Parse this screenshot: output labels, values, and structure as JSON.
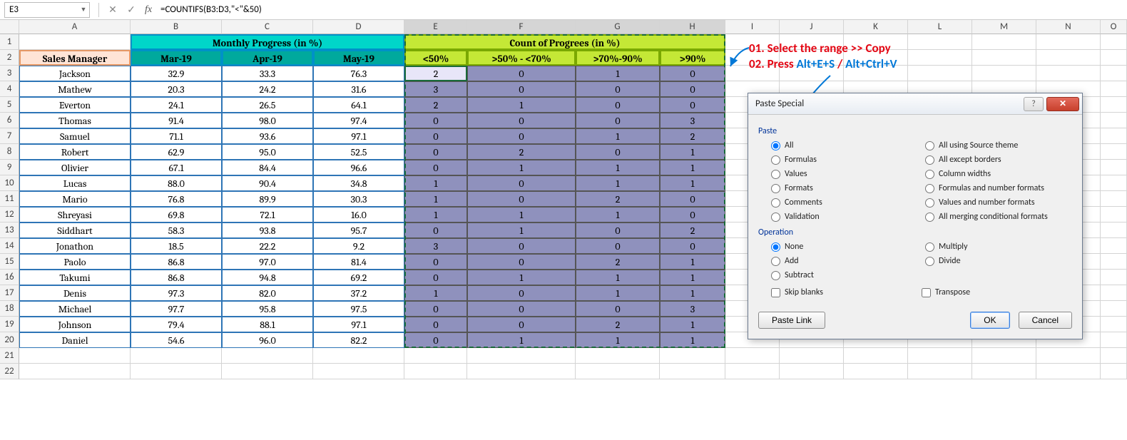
{
  "namebox": "E3",
  "formula": "=COUNTIFS(B3:D3,\"<\"&50)",
  "colHeaders": [
    "A",
    "B",
    "C",
    "D",
    "E",
    "F",
    "G",
    "H",
    "I",
    "J",
    "K",
    "L",
    "M",
    "N",
    "O"
  ],
  "rowCount": 22,
  "titles": {
    "monthly": "Monthly Progress (in %)",
    "count": "Count of Progrees (in %)"
  },
  "headers": {
    "salesManager": "Sales Manager",
    "months": [
      "Mar-19",
      "Apr-19",
      "May-19"
    ],
    "counts": [
      "<50%",
      ">50% - <70%",
      ">70%-90%",
      ">90%"
    ]
  },
  "rows": [
    {
      "name": "Jackson",
      "p": [
        "32.9",
        "33.3",
        "76.3"
      ],
      "c": [
        "2",
        "0",
        "1",
        "0"
      ]
    },
    {
      "name": "Mathew",
      "p": [
        "20.3",
        "24.2",
        "31.6"
      ],
      "c": [
        "3",
        "0",
        "0",
        "0"
      ]
    },
    {
      "name": "Everton",
      "p": [
        "24.1",
        "26.5",
        "64.1"
      ],
      "c": [
        "2",
        "1",
        "0",
        "0"
      ]
    },
    {
      "name": "Thomas",
      "p": [
        "91.4",
        "98.0",
        "97.4"
      ],
      "c": [
        "0",
        "0",
        "0",
        "3"
      ]
    },
    {
      "name": "Samuel",
      "p": [
        "71.1",
        "93.6",
        "97.1"
      ],
      "c": [
        "0",
        "0",
        "1",
        "2"
      ]
    },
    {
      "name": "Robert",
      "p": [
        "62.9",
        "95.0",
        "52.5"
      ],
      "c": [
        "0",
        "2",
        "0",
        "1"
      ]
    },
    {
      "name": "Olivier",
      "p": [
        "67.1",
        "84.4",
        "96.6"
      ],
      "c": [
        "0",
        "1",
        "1",
        "1"
      ]
    },
    {
      "name": "Lucas",
      "p": [
        "88.0",
        "90.4",
        "34.8"
      ],
      "c": [
        "1",
        "0",
        "1",
        "1"
      ]
    },
    {
      "name": "Mario",
      "p": [
        "76.8",
        "89.9",
        "30.3"
      ],
      "c": [
        "1",
        "0",
        "2",
        "0"
      ]
    },
    {
      "name": "Shreyasi",
      "p": [
        "69.8",
        "72.1",
        "16.0"
      ],
      "c": [
        "1",
        "1",
        "1",
        "0"
      ]
    },
    {
      "name": "Siddhart",
      "p": [
        "58.3",
        "93.8",
        "95.7"
      ],
      "c": [
        "0",
        "1",
        "0",
        "2"
      ]
    },
    {
      "name": "Jonathon",
      "p": [
        "18.5",
        "22.2",
        "9.2"
      ],
      "c": [
        "3",
        "0",
        "0",
        "0"
      ]
    },
    {
      "name": "Paolo",
      "p": [
        "86.8",
        "97.0",
        "81.4"
      ],
      "c": [
        "0",
        "0",
        "2",
        "1"
      ]
    },
    {
      "name": "Takumi",
      "p": [
        "86.8",
        "94.8",
        "69.2"
      ],
      "c": [
        "0",
        "1",
        "1",
        "1"
      ]
    },
    {
      "name": "Denis",
      "p": [
        "97.3",
        "82.0",
        "37.2"
      ],
      "c": [
        "1",
        "0",
        "1",
        "1"
      ]
    },
    {
      "name": "Michael",
      "p": [
        "97.7",
        "95.8",
        "97.5"
      ],
      "c": [
        "0",
        "0",
        "0",
        "3"
      ]
    },
    {
      "name": "Johnson",
      "p": [
        "79.4",
        "88.1",
        "97.1"
      ],
      "c": [
        "0",
        "0",
        "2",
        "1"
      ]
    },
    {
      "name": "Daniel",
      "p": [
        "54.6",
        "96.0",
        "82.2"
      ],
      "c": [
        "0",
        "1",
        "1",
        "1"
      ]
    }
  ],
  "annot": {
    "line1a": "01. Select the range >> Copy",
    "line2a": "02. Press ",
    "line2b": "Alt+E+S",
    "line2c": " / ",
    "line2d": "Alt+Ctrl+V"
  },
  "dialog": {
    "title": "Paste Special",
    "groups": {
      "paste": "Paste",
      "operation": "Operation"
    },
    "paste": {
      "left": [
        "All",
        "Formulas",
        "Values",
        "Formats",
        "Comments",
        "Validation"
      ],
      "right": [
        "All using Source theme",
        "All except borders",
        "Column widths",
        "Formulas and number formats",
        "Values and number formats",
        "All merging conditional formats"
      ]
    },
    "op": {
      "left": [
        "None",
        "Add",
        "Subtract"
      ],
      "right": [
        "Multiply",
        "Divide"
      ]
    },
    "skip": "Skip blanks",
    "transpose": "Transpose",
    "pastelink": "Paste Link",
    "ok": "OK",
    "cancel": "Cancel"
  }
}
